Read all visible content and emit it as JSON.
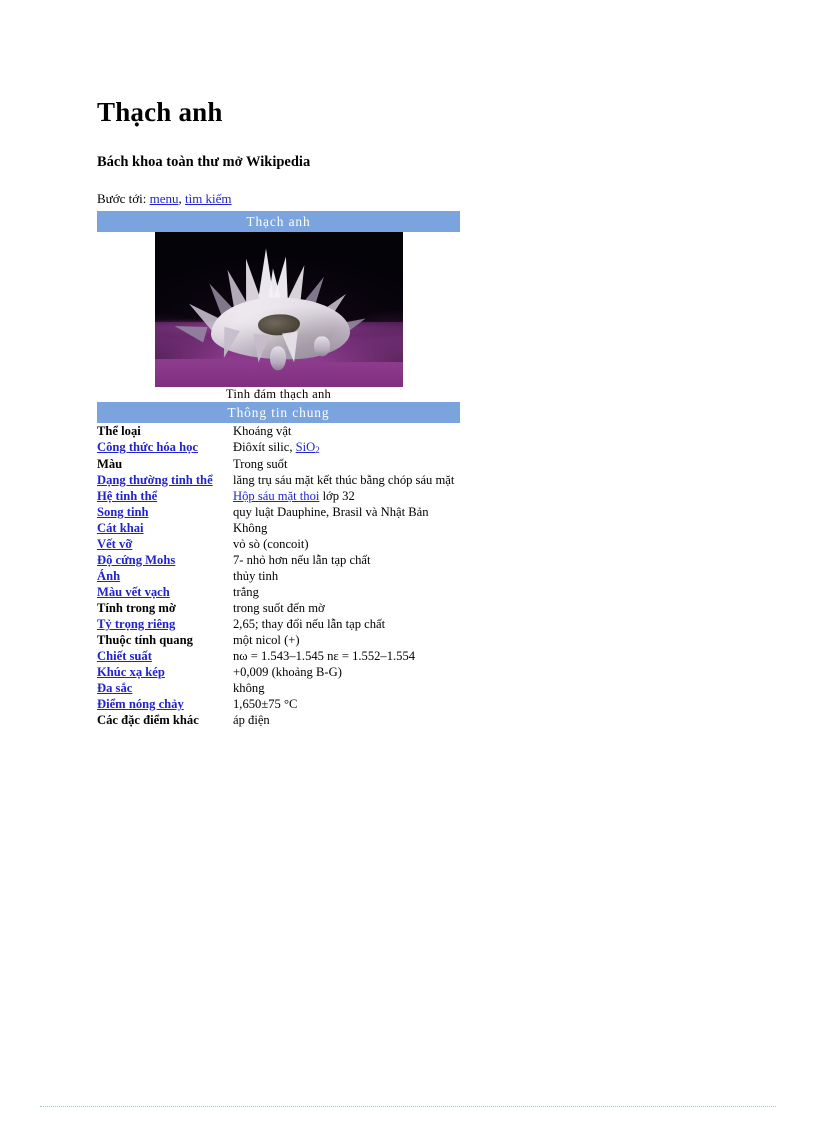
{
  "article": {
    "title": "Thạch anh",
    "subtitle": "Bách khoa toàn thư mở Wikipedia"
  },
  "jumpto": {
    "label": "Bước tới:",
    "link_menu": "menu",
    "separator": ",",
    "link_search": "tìm kiếm"
  },
  "infobox": {
    "title": "Thạch anh",
    "image_caption": "Tinh đám thạch anh",
    "section_header": "Thông tin chung",
    "rows": [
      {
        "label": "Thể loại",
        "label_is_link": false,
        "value": "Khoáng vật",
        "value_link": ""
      },
      {
        "label": "Công thức hóa học",
        "label_is_link": true,
        "value": "Điôxít silic,",
        "value_link": "SiO2"
      },
      {
        "label": "Màu",
        "label_is_link": false,
        "value": "Trong suốt",
        "value_link": ""
      },
      {
        "label": "Dạng thường tinh thể",
        "label_is_link": true,
        "value": "lăng trụ sáu mặt kết thúc bằng chóp sáu mặt",
        "value_link": ""
      },
      {
        "label": "Hệ tinh thể",
        "label_is_link": true,
        "value": "lớp 32",
        "value_link": "Hộp sáu mặt thoi"
      },
      {
        "label": "Song tinh",
        "label_is_link": true,
        "value": "quy luật Dauphine, Brasil và Nhật Bản",
        "value_link": ""
      },
      {
        "label": "Cát khai",
        "label_is_link": true,
        "value": "Không",
        "value_link": ""
      },
      {
        "label": "Vết vỡ",
        "label_is_link": true,
        "value": "vỏ sò (concoit)",
        "value_link": ""
      },
      {
        "label": "Độ cứng Mohs",
        "label_is_link": true,
        "value": "7- nhỏ hơn nếu lẫn tạp chất",
        "value_link": ""
      },
      {
        "label": "Ánh",
        "label_is_link": true,
        "value": "thủy tinh",
        "value_link": ""
      },
      {
        "label": "Màu vết vạch",
        "label_is_link": true,
        "value": "trắng",
        "value_link": ""
      },
      {
        "label": "Tính trong mờ",
        "label_is_link": false,
        "value": "trong suốt đến mờ",
        "value_link": ""
      },
      {
        "label": "Tỷ trọng riêng",
        "label_is_link": true,
        "value": "2,65; thay đổi nếu lẫn tạp chất",
        "value_link": ""
      },
      {
        "label": "Thuộc tính quang",
        "label_is_link": false,
        "value": "một nicol (+)",
        "value_link": ""
      },
      {
        "label": "Chiết suất",
        "label_is_link": true,
        "value": "nω = 1.543–1.545 nε = 1.552–1.554",
        "value_link": ""
      },
      {
        "label": "Khúc xạ kép",
        "label_is_link": true,
        "value": "+0,009 (khoảng B-G)",
        "value_link": ""
      },
      {
        "label": "Đa sắc",
        "label_is_link": true,
        "value": "không",
        "value_link": ""
      },
      {
        "label": "Điểm nóng chảy",
        "label_is_link": true,
        "value": "1,650±75 °C",
        "value_link": ""
      },
      {
        "label": "Các đặc điểm khác",
        "label_is_link": false,
        "value": "áp điện",
        "value_link": ""
      }
    ]
  },
  "colors": {
    "header_blue": "#7ba3dd",
    "link_blue": "#2222cc",
    "text_black": "#000000",
    "photo_purple": "#8e3c8e",
    "footer_rule": "#9ec4e8"
  }
}
